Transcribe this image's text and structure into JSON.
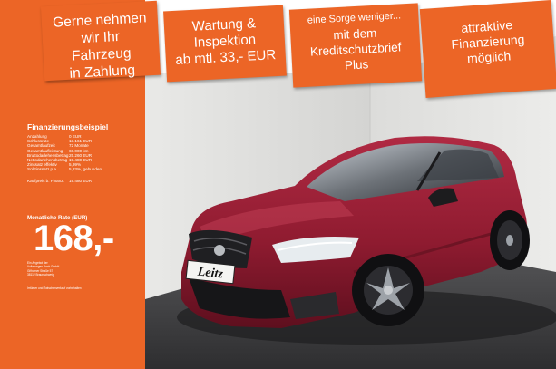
{
  "banners": [
    {
      "lines": [
        "Gerne nehmen",
        "wir Ihr",
        "Fahrzeug",
        "in Zahlung"
      ]
    },
    {
      "lines": [
        "Wartung &",
        "Inspektion",
        "ab mtl. 33,- EUR"
      ]
    },
    {
      "lines": [
        "eine Sorge weniger...",
        "mit dem",
        "Kreditschutzbrief",
        "Plus"
      ]
    },
    {
      "lines": [
        "attraktive",
        "Finanzierung",
        "möglich"
      ]
    }
  ],
  "financing": {
    "title": "Finanzierungsbeispiel",
    "rows": [
      {
        "label": "Anzahlung",
        "value": "0 EUR"
      },
      {
        "label": "Schlussrate",
        "value": "13.161 EUR"
      },
      {
        "label": "Gesamtlaufzeit",
        "value": "72 Monate"
      },
      {
        "label": "Gesamtlaufleistung",
        "value": "60.000 km"
      },
      {
        "label": "Bruttodarlehensbetrag",
        "value": "25.260 EUR"
      },
      {
        "label": "Nettodarlehensbetrag",
        "value": "19.480 EUR"
      },
      {
        "label": "Zinssatz effektiv",
        "value": "5,99%"
      },
      {
        "label": "Sollzinssatz p.a.",
        "value": "5,83%, gebunden"
      }
    ],
    "purchase_label": "Kaufpreis b. Finanz.",
    "purchase_value": "19.480 EUR",
    "rate_label": "Monatliche Rate (EUR)",
    "rate_value": "168,-",
    "lender_lines": [
      "Ein Angebot der",
      "Volkswagen Bank GmbH",
      "Gifhorner Straße 57",
      "38112 Braunschweig"
    ],
    "footnote": "Irrtümer und Zwischenverkauf vorbehalten"
  },
  "dealer_plate": "Leitz",
  "colors": {
    "brand_orange": "#ec6526",
    "car_red": "#8f1b30",
    "floor": "#3a3a3c"
  }
}
